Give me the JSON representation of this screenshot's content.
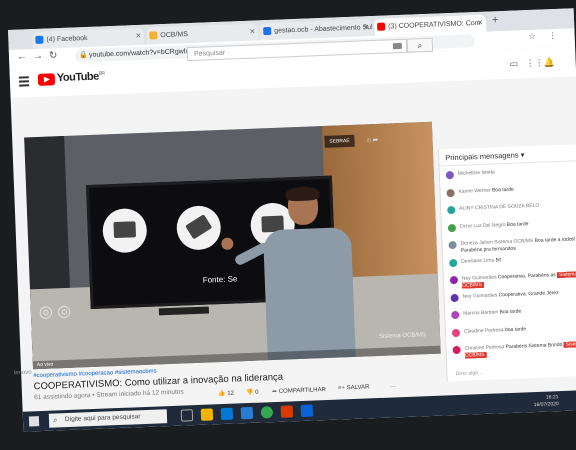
{
  "browser": {
    "tabs": [
      {
        "label": "(4) Facebook",
        "color": "#1877f2",
        "active": false
      },
      {
        "label": "OCB/MS",
        "color": "#f2b233",
        "active": false
      },
      {
        "label": "gestao.ocb - Abastecimento Sul",
        "color": "#1a73e8",
        "active": false
      },
      {
        "label": "(3) COOPERATIVISMO: Com",
        "color": "#ff0000",
        "active": true
      }
    ],
    "url": "youtube.com/watch?v=bCRgwlxRkt0&feature=youtu.be"
  },
  "youtube": {
    "logo_text": "YouTube",
    "region": "BR",
    "search_placeholder": "Pesquisar"
  },
  "video": {
    "screen_caption": "Fonte: Se",
    "mini_label": "SEBRAE",
    "brand": "Sistema OCB/MS",
    "ctrl_text": "Ao vivo",
    "hashtags": "#cooperativismo #cooperacao #sistemaocbms",
    "title": "COOPERATIVISMO: Como utilizar a inovação na liderança",
    "meta": "61 assistindo agora • Stream iniciado há 12 minutos",
    "likes": "12",
    "dislikes": "0",
    "share_label": "COMPARTILHAR",
    "save_label": "SALVAR"
  },
  "chat": {
    "header": "Principais mensagens",
    "messages": [
      {
        "name": "Michelline Ishida",
        "text": "",
        "color": "#7e57c2"
      },
      {
        "name": "Karine Werner",
        "text": "Boa tarde",
        "color": "#8d6e63"
      },
      {
        "name": "ALINY CRISTINA DE SOUZA BELO",
        "text": "",
        "color": "#26a69a"
      },
      {
        "name": "Octor Luz Del Negro",
        "text": "Boa tarde",
        "color": "#43a047"
      },
      {
        "name": "Deneza Jahen Sistema OCB/MS",
        "text": "Boa tarde a todos! Parabéns pra formandos",
        "color": "#78909c"
      },
      {
        "name": "Deniliane Lima",
        "text": "50",
        "color": "#26a69a"
      },
      {
        "name": "Ney Guimarães",
        "text": "Cooperativa. Parabéns as",
        "color": "#8e24aa"
      },
      {
        "name": "Ney Guimarães",
        "text": "Cooperativa. Grande Jerez",
        "color": "#5e35b1"
      },
      {
        "name": "Marcos Barbieri",
        "text": "Boa tarde",
        "color": "#ab47bc"
      },
      {
        "name": "Claudine Pedrosa",
        "text": "boa tarde",
        "color": "#ec407a"
      },
      {
        "name": "Christine Pedrosa",
        "text": "Parabéns Sistema Brindo",
        "color": "#d81b60"
      }
    ],
    "badge": "Sistema OCB/MS",
    "input_label": "Dizer algo..."
  },
  "taskbar": {
    "search_placeholder": "Digite aqui para pesquisar",
    "time": "16:21",
    "date": "16/07/2020"
  },
  "desk_text": "lenovo"
}
